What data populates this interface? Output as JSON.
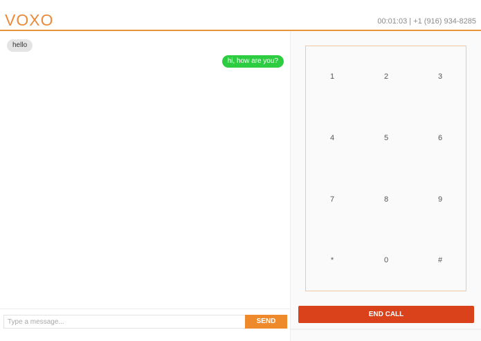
{
  "header": {
    "logo": "VOXO",
    "call_info": "00:01:03 | +1 (916) 934-8285"
  },
  "chat": {
    "messages": [
      {
        "direction": "incoming",
        "text": "hello"
      },
      {
        "direction": "outgoing",
        "text": "hi, how are you?"
      }
    ],
    "composer": {
      "placeholder": "Type a message...",
      "value": "",
      "send_label": "SEND"
    }
  },
  "keypad": {
    "keys": [
      "1",
      "2",
      "3",
      "4",
      "5",
      "6",
      "7",
      "8",
      "9",
      "*",
      "0",
      "#"
    ]
  },
  "end_call_label": "END CALL",
  "colors": {
    "accent": "#ee8a2c",
    "outgoing_bubble": "#2ecc40",
    "incoming_bubble": "#e4e4e4",
    "end_call": "#d9421b"
  }
}
